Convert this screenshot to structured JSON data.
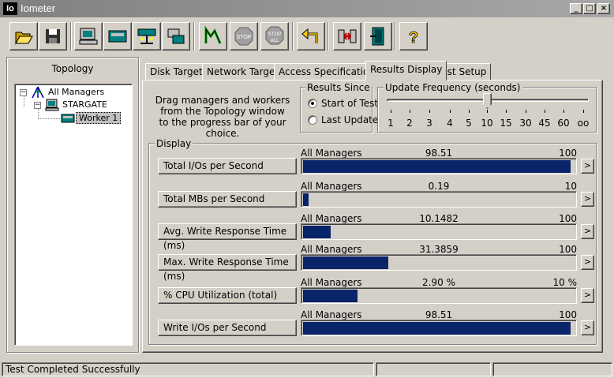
{
  "app": {
    "icon_text": "Io",
    "title": "Iometer"
  },
  "window_controls": {
    "minimize": "_",
    "maximize": "□",
    "close": "×"
  },
  "toolbar": {
    "buttons": [
      "open-icon",
      "save-icon",
      "start-manager-icon",
      "disk-worker-icon",
      "network-worker-icon",
      "duplicate-worker-icon",
      "start-test-icon",
      "stop-icon",
      "stop-all-icon",
      "reset-icon",
      "disconnect-icon",
      "exit-icon",
      "help-icon"
    ],
    "stop_label": "STOP",
    "stop_all_label": "STOP",
    "stop_all_sub": "ALL",
    "help_label": "?"
  },
  "topology": {
    "title": "Topology",
    "tree": [
      {
        "label": "All Managers",
        "level": 0,
        "expander": "−"
      },
      {
        "label": "STARGATE",
        "level": 1,
        "expander": "−"
      },
      {
        "label": "Worker 1",
        "level": 2,
        "selected": true
      }
    ]
  },
  "tabs": [
    {
      "label": "Disk Targets",
      "active": false
    },
    {
      "label": "Network Targets",
      "active": false
    },
    {
      "label": "Access Specifications",
      "active": false
    },
    {
      "label": "Results Display",
      "active": true
    },
    {
      "label": "Test Setup",
      "active": false
    }
  ],
  "instructions": {
    "line1": "Drag managers and workers",
    "line2": "from the Topology window",
    "line3": "to the progress bar of your choice."
  },
  "results_since": {
    "title": "Results Since",
    "options": [
      {
        "label": "Start of Test",
        "selected": true
      },
      {
        "label": "Last Update",
        "selected": false
      }
    ]
  },
  "update_frequency": {
    "title": "Update Frequency (seconds)",
    "ticks": [
      "1",
      "2",
      "3",
      "4",
      "5",
      "10",
      "15",
      "30",
      "45",
      "60",
      "oo"
    ],
    "selected": "10"
  },
  "display": {
    "title": "Display",
    "metrics": [
      {
        "label": "Total I/Os per Second",
        "source": "All Managers",
        "value": "98.51",
        "max": "100",
        "fraction": 0.9851
      },
      {
        "label": "Total MBs per Second",
        "source": "All Managers",
        "value": "0.19",
        "max": "10",
        "fraction": 0.019
      },
      {
        "label": "Avg. Write Response Time (ms)",
        "source": "All Managers",
        "value": "10.1482",
        "max": "100",
        "fraction": 0.101
      },
      {
        "label": "Max. Write Response Time (ms)",
        "source": "All Managers",
        "value": "31.3859",
        "max": "100",
        "fraction": 0.314
      },
      {
        "label": "% CPU Utilization (total)",
        "source": "All Managers",
        "value": "2.90 %",
        "max": "10 %",
        "fraction": 0.2
      },
      {
        "label": "Write I/Os per Second",
        "source": "All Managers",
        "value": "98.51",
        "max": "100",
        "fraction": 0.9851
      }
    ],
    "arrow": ">"
  },
  "status": {
    "message": "Test Completed Successfully"
  },
  "colors": {
    "bar": "#0a246a",
    "face": "#d4d0c8"
  }
}
